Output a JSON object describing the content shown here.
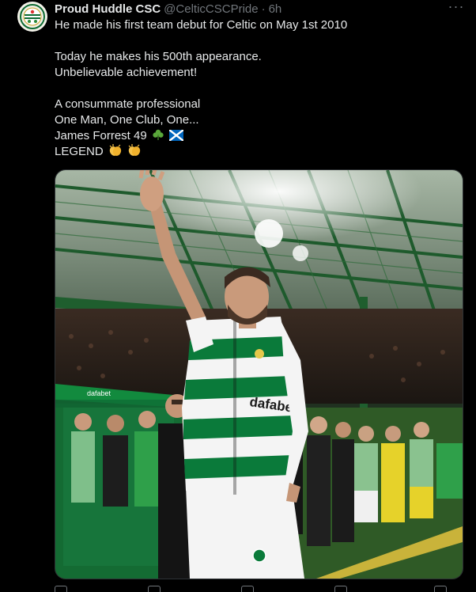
{
  "author": {
    "display_name": "Proud Huddle CSC",
    "handle": "@CelticCSCPride",
    "separator": "·",
    "time": "6h",
    "avatar_icon": "club-crest-icon"
  },
  "menu": {
    "more_icon": "more-dots-icon",
    "more_glyph": "···"
  },
  "post": {
    "line1": "He made his first team debut for Celtic on May 1st 2010",
    "line2": "Today he makes his 500th appearance.",
    "line3": "Unbelievable achievement!",
    "line4": "A consummate professional",
    "line5": "One Man, One Club, One...",
    "line6": "James Forrest 49",
    "line6_emojis": [
      "shamrock-emoji",
      "scotland-flag-emoji"
    ],
    "line7": "LEGEND",
    "line7_emojis": [
      "clapping-hands-emoji",
      "clapping-hands-emoji"
    ]
  },
  "media": {
    "image_icon": "player-waving-photo",
    "shirt_sponsor": "dafabet",
    "hoarding_text": "dafabet"
  },
  "colors": {
    "background": "#000000",
    "text": "#e7e9ea",
    "muted": "#71767b",
    "celtic_green": "#0a7a3a"
  }
}
